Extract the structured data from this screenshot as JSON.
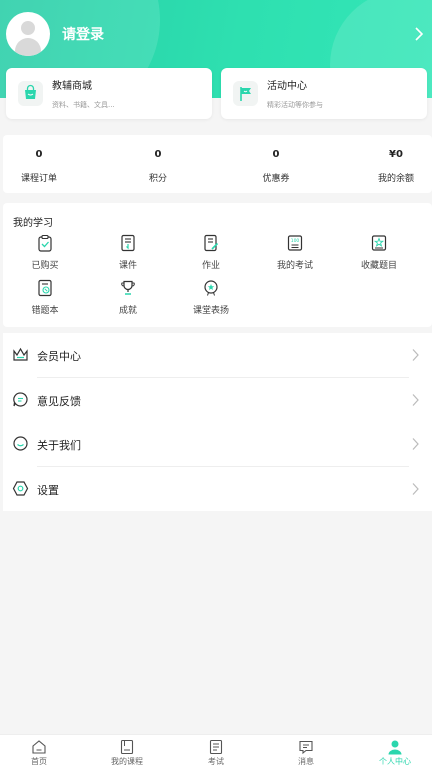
{
  "header": {
    "login_label": "请登录"
  },
  "promo": {
    "shop": {
      "title": "教辅商城",
      "subtitle": "资料、书籍、文具..."
    },
    "activity": {
      "title": "活动中心",
      "subtitle": "精彩活动等你参与"
    }
  },
  "stats": [
    {
      "value": "0",
      "label": "课程订单"
    },
    {
      "value": "0",
      "label": "积分"
    },
    {
      "value": "0",
      "label": "优惠券"
    },
    {
      "value": "¥0",
      "label": "我的余额"
    }
  ],
  "study": {
    "title": "我的学习",
    "items": [
      {
        "label": "已购买",
        "icon": "clipboard-check-icon"
      },
      {
        "label": "课件",
        "icon": "document-download-icon"
      },
      {
        "label": "作业",
        "icon": "document-edit-icon"
      },
      {
        "label": "我的考试",
        "icon": "exam-score-icon"
      },
      {
        "label": "收藏题目",
        "icon": "bookmark-star-icon"
      },
      {
        "label": "错题本",
        "icon": "error-book-icon"
      },
      {
        "label": "成就",
        "icon": "trophy-icon"
      },
      {
        "label": "课堂表扬",
        "icon": "medal-icon"
      }
    ]
  },
  "menu": [
    {
      "label": "会员中心",
      "icon": "crown-icon"
    },
    {
      "label": "意见反馈",
      "icon": "feedback-icon"
    },
    {
      "label": "关于我们",
      "icon": "smile-icon"
    },
    {
      "label": "设置",
      "icon": "settings-icon"
    }
  ],
  "tabs": [
    {
      "label": "首页",
      "icon": "home-icon"
    },
    {
      "label": "我的课程",
      "icon": "course-icon"
    },
    {
      "label": "考试",
      "icon": "exam-icon"
    },
    {
      "label": "消息",
      "icon": "message-icon"
    },
    {
      "label": "个人中心",
      "icon": "profile-icon"
    }
  ],
  "colors": {
    "accent": "#2ad6ad",
    "header_gradient_start": "#27cda7",
    "header_gradient_end": "#34e6b8"
  }
}
